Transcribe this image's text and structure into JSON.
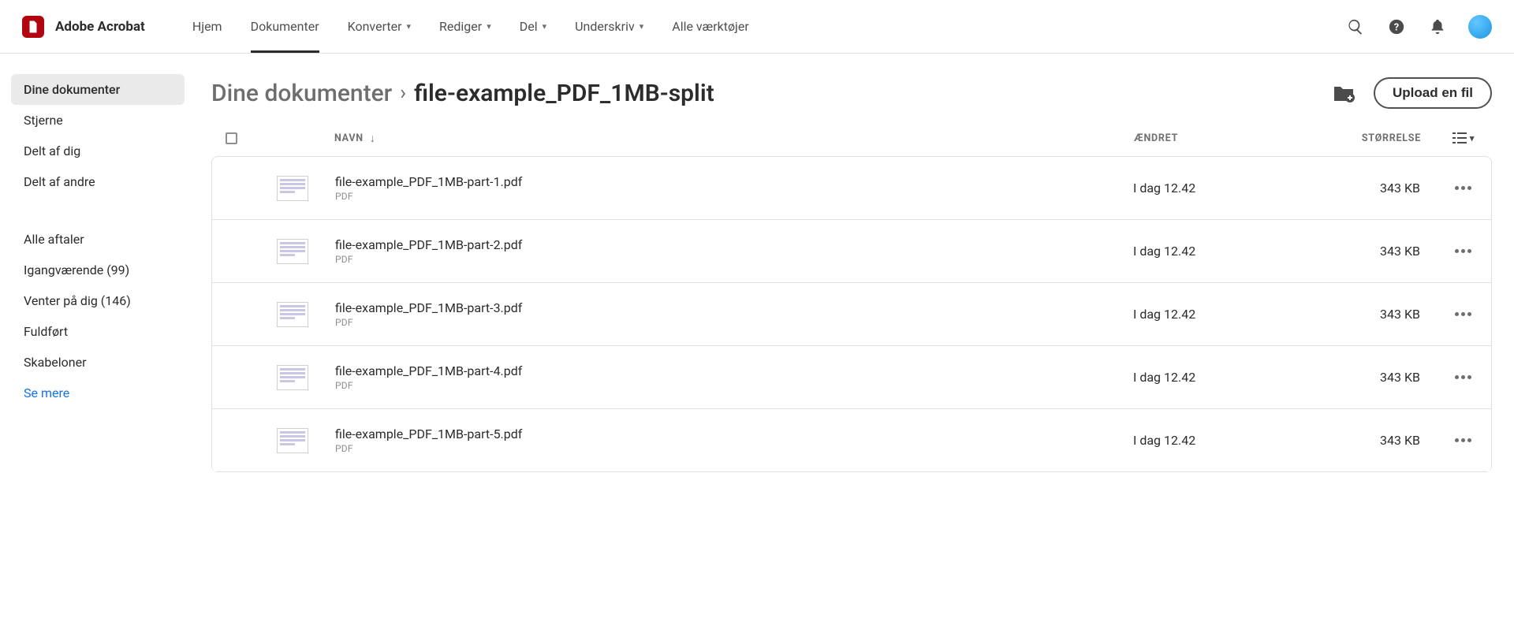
{
  "product_name": "Adobe Acrobat",
  "nav": {
    "home": "Hjem",
    "documents": "Dokumenter",
    "convert": "Konverter",
    "edit": "Rediger",
    "share": "Del",
    "sign": "Underskriv",
    "tools": "Alle værktøjer"
  },
  "sidebar": {
    "group1": {
      "your_docs": "Dine dokumenter",
      "stars": "Stjerne",
      "shared_by_you": "Delt af dig",
      "shared_by_others": "Delt af andre"
    },
    "group2": {
      "all_agreements": "Alle aftaler",
      "in_progress": "Igangværende (99)",
      "waiting": "Venter på dig (146)",
      "completed": "Fuldført",
      "templates": "Skabeloner",
      "see_more": "Se mere"
    }
  },
  "breadcrumb": {
    "parent": "Dine dokumenter",
    "current": "file-example_PDF_1MB-split"
  },
  "upload_label": "Upload en fil",
  "columns": {
    "name": "NAVN",
    "modified": "ÆNDRET",
    "size": "STØRRELSE"
  },
  "files": [
    {
      "name": "file-example_PDF_1MB-part-1.pdf",
      "type": "PDF",
      "modified": "I dag 12.42",
      "size": "343 KB"
    },
    {
      "name": "file-example_PDF_1MB-part-2.pdf",
      "type": "PDF",
      "modified": "I dag 12.42",
      "size": "343 KB"
    },
    {
      "name": "file-example_PDF_1MB-part-3.pdf",
      "type": "PDF",
      "modified": "I dag 12.42",
      "size": "343 KB"
    },
    {
      "name": "file-example_PDF_1MB-part-4.pdf",
      "type": "PDF",
      "modified": "I dag 12.42",
      "size": "343 KB"
    },
    {
      "name": "file-example_PDF_1MB-part-5.pdf",
      "type": "PDF",
      "modified": "I dag 12.42",
      "size": "343 KB"
    }
  ]
}
